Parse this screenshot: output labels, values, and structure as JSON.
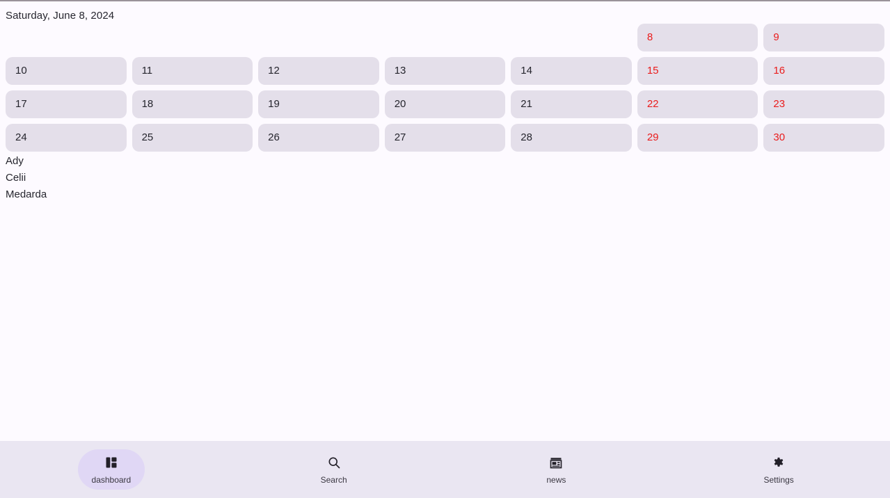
{
  "header": {
    "date_text": "Saturday, June 8, 2024"
  },
  "calendar": {
    "rows": [
      [
        {
          "label": "",
          "empty": true,
          "weekend": false
        },
        {
          "label": "",
          "empty": true,
          "weekend": false
        },
        {
          "label": "",
          "empty": true,
          "weekend": false
        },
        {
          "label": "",
          "empty": true,
          "weekend": false
        },
        {
          "label": "",
          "empty": true,
          "weekend": false
        },
        {
          "label": "8",
          "empty": false,
          "weekend": true
        },
        {
          "label": "9",
          "empty": false,
          "weekend": true
        }
      ],
      [
        {
          "label": "10",
          "empty": false,
          "weekend": false
        },
        {
          "label": "11",
          "empty": false,
          "weekend": false
        },
        {
          "label": "12",
          "empty": false,
          "weekend": false
        },
        {
          "label": "13",
          "empty": false,
          "weekend": false
        },
        {
          "label": "14",
          "empty": false,
          "weekend": false
        },
        {
          "label": "15",
          "empty": false,
          "weekend": true
        },
        {
          "label": "16",
          "empty": false,
          "weekend": true
        }
      ],
      [
        {
          "label": "17",
          "empty": false,
          "weekend": false
        },
        {
          "label": "18",
          "empty": false,
          "weekend": false
        },
        {
          "label": "19",
          "empty": false,
          "weekend": false
        },
        {
          "label": "20",
          "empty": false,
          "weekend": false
        },
        {
          "label": "21",
          "empty": false,
          "weekend": false
        },
        {
          "label": "22",
          "empty": false,
          "weekend": true
        },
        {
          "label": "23",
          "empty": false,
          "weekend": true
        }
      ],
      [
        {
          "label": "24",
          "empty": false,
          "weekend": false
        },
        {
          "label": "25",
          "empty": false,
          "weekend": false
        },
        {
          "label": "26",
          "empty": false,
          "weekend": false
        },
        {
          "label": "27",
          "empty": false,
          "weekend": false
        },
        {
          "label": "28",
          "empty": false,
          "weekend": false
        },
        {
          "label": "29",
          "empty": false,
          "weekend": true
        },
        {
          "label": "30",
          "empty": false,
          "weekend": true
        }
      ]
    ]
  },
  "names": [
    "Ady",
    "Celii",
    "Medarda"
  ],
  "bottom_nav": {
    "items": [
      {
        "label": "dashboard",
        "icon": "dashboard-icon",
        "active": true
      },
      {
        "label": "Search",
        "icon": "search-icon",
        "active": false
      },
      {
        "label": "news",
        "icon": "news-icon",
        "active": false
      },
      {
        "label": "Settings",
        "icon": "gear-icon",
        "active": false
      }
    ]
  },
  "colors": {
    "page_background": "#fdfaff",
    "cell_background": "#e4dfea",
    "weekend_text": "#ea1c1c",
    "weekday_text": "#25252d",
    "nav_background": "#eae6f2",
    "nav_active_pill": "#e0d7f5"
  }
}
